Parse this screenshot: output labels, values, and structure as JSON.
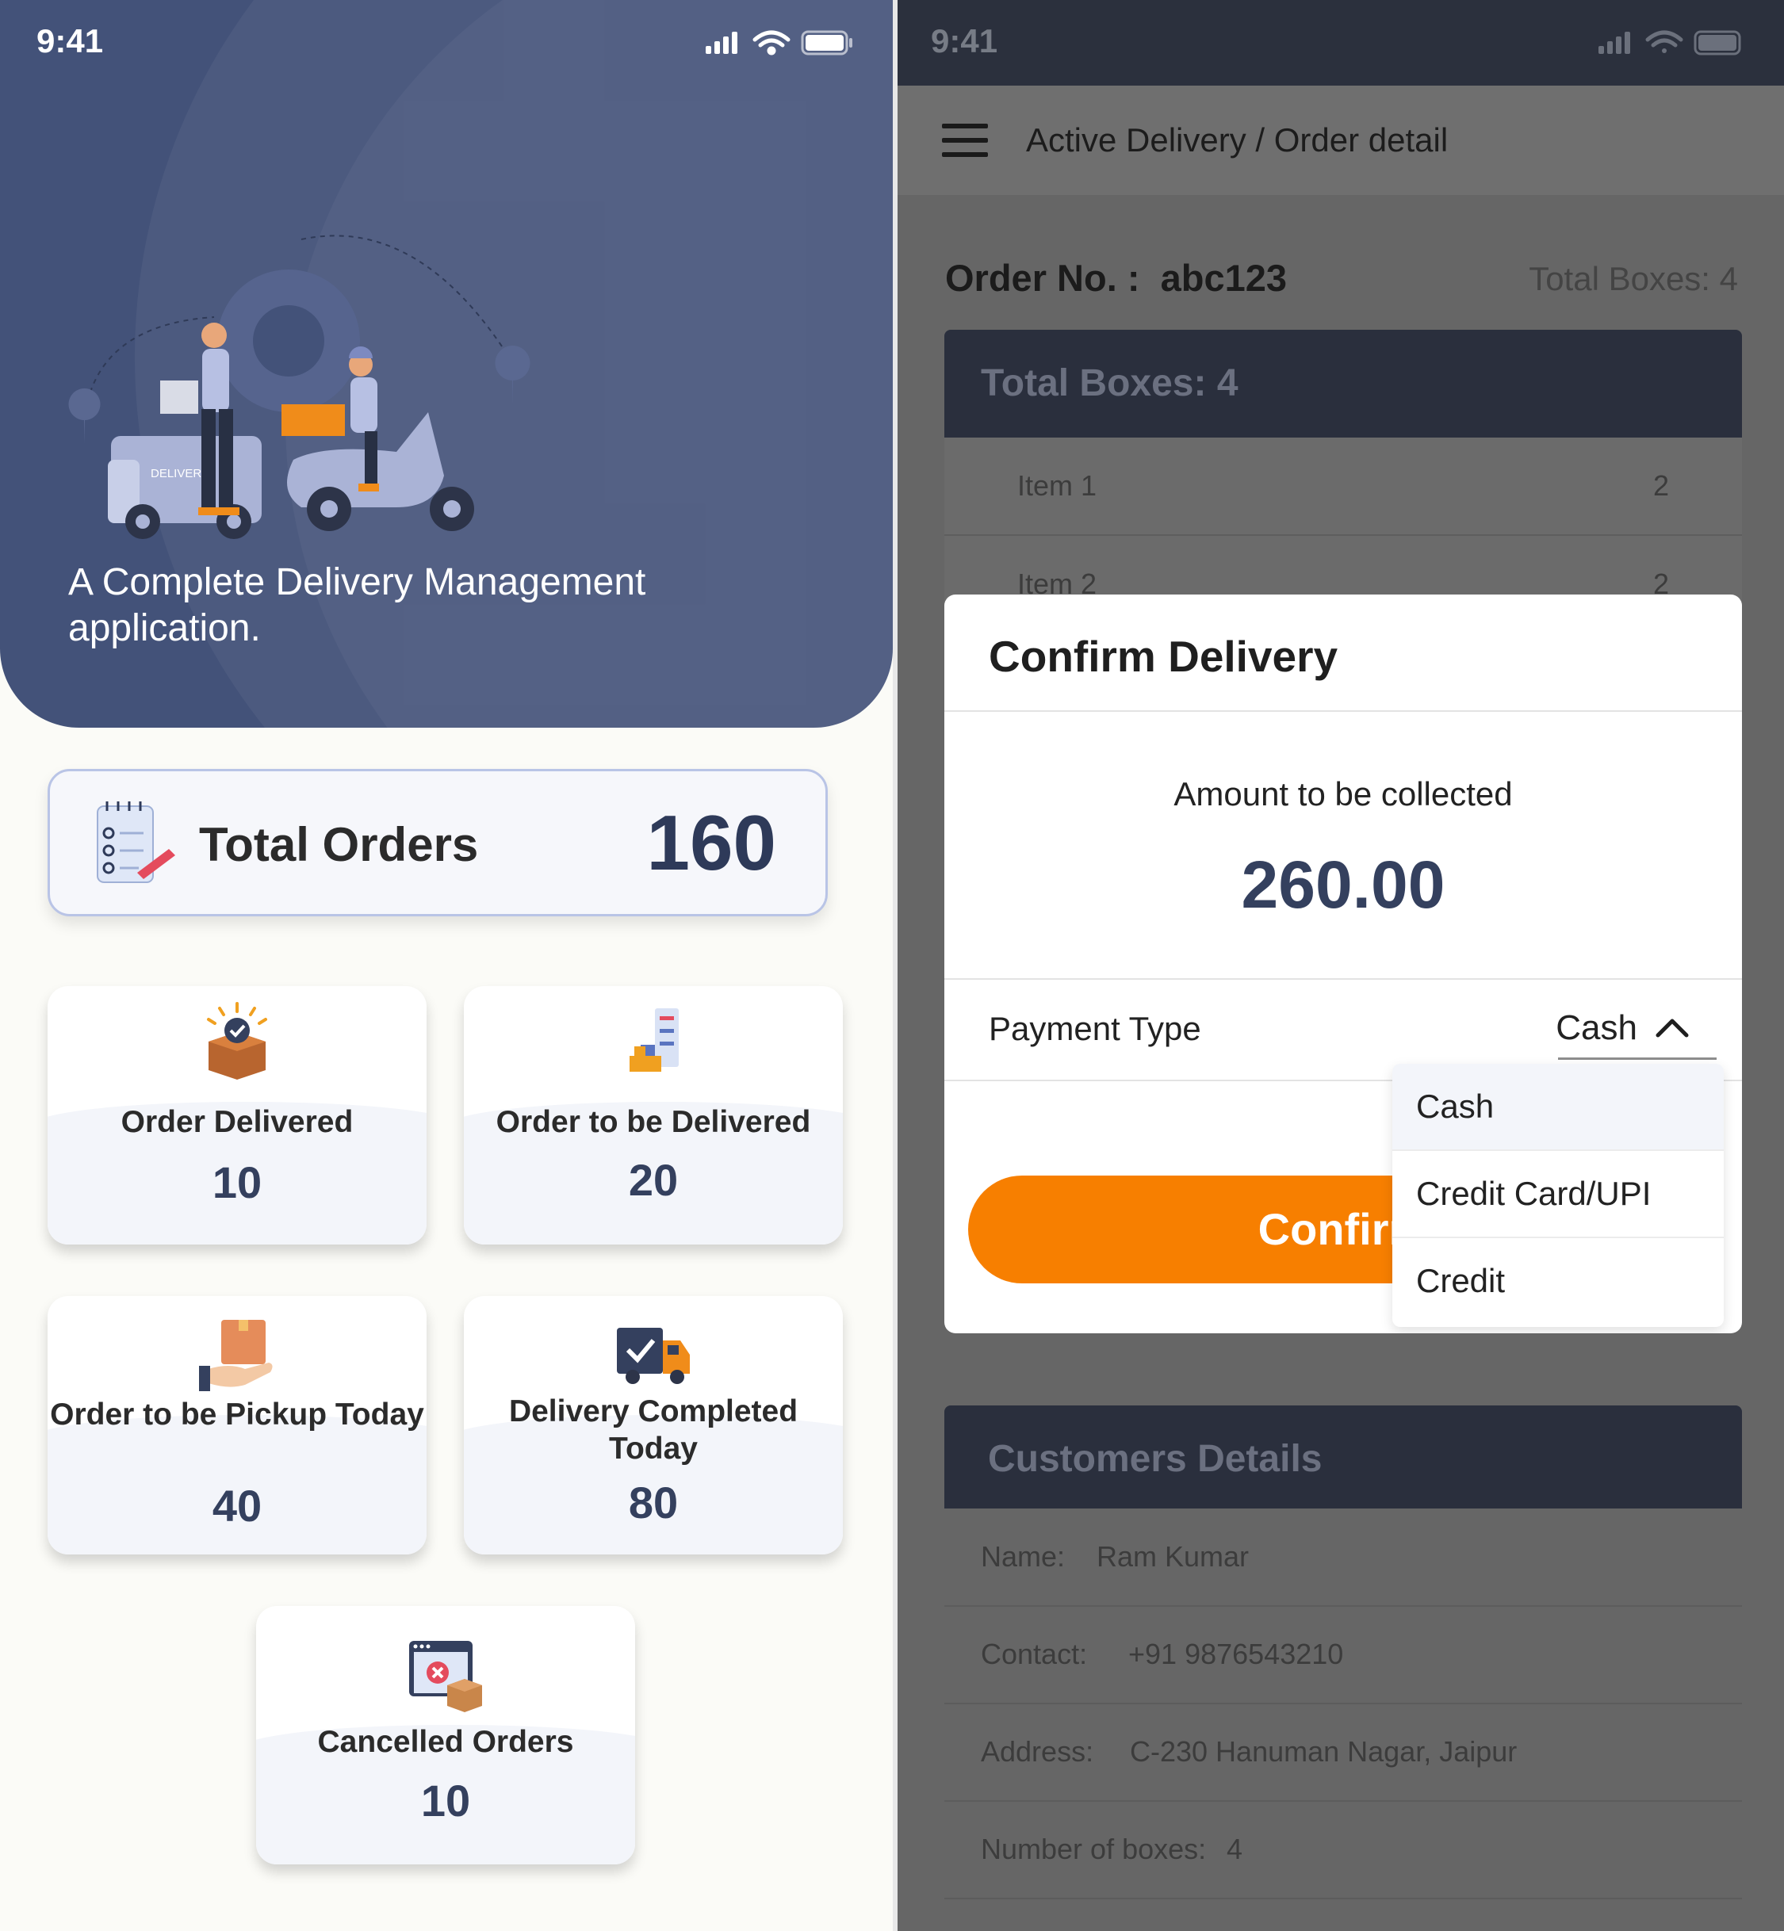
{
  "left_screen": {
    "status_time": "9:41",
    "hero": {
      "tagline": "A Complete Delivery Management application.",
      "illustration_text": "DELIVERY"
    },
    "total_orders": {
      "label": "Total Orders",
      "value": "160"
    },
    "stats": [
      {
        "label": "Order Delivered",
        "value": "10",
        "icon": "box-check-icon"
      },
      {
        "label": "Order to be Delivered",
        "value": "20",
        "icon": "warehouse-icon"
      },
      {
        "label": "Order to be Pickup Today",
        "value": "40",
        "icon": "hand-package-icon"
      },
      {
        "label": "Delivery Completed Today",
        "value": "80",
        "icon": "truck-check-icon"
      },
      {
        "label": "Cancelled Orders",
        "value": "10",
        "icon": "cancelled-order-icon"
      }
    ]
  },
  "right_screen": {
    "status_time": "9:41",
    "header": {
      "breadcrumb": "Active Delivery / Order detail"
    },
    "order": {
      "number_label": "Order No. :",
      "number": "abc123",
      "total_boxes": "Total Boxes: 4"
    },
    "boxes_panel": {
      "title": "Total Boxes: 4",
      "items": [
        {
          "name": "Item 1",
          "qty": "2"
        },
        {
          "name": "Item 2",
          "qty": "2"
        }
      ]
    },
    "modal": {
      "title": "Confirm Delivery",
      "amount_label": "Amount to be collected",
      "amount": "260.00",
      "payment_label": "Payment Type",
      "payment_selected": "Cash",
      "confirm_label": "Confirm",
      "payment_options": [
        "Cash",
        "Credit Card/UPI",
        "Credit"
      ]
    },
    "customer": {
      "title": "Customers Details",
      "rows": [
        {
          "key": "Name:",
          "value": "Ram Kumar"
        },
        {
          "key": "Contact:",
          "value": "+91 9876543210"
        },
        {
          "key": "Address:",
          "value": "C-230 Hanuman Nagar, Jaipur"
        },
        {
          "key": "Number of boxes:",
          "value": "4"
        }
      ]
    }
  },
  "colors": {
    "hero_bg": "#435279",
    "accent_orange": "#f77f00",
    "value_navy": "#34405e",
    "panel_dark": "#2a2f3d"
  }
}
